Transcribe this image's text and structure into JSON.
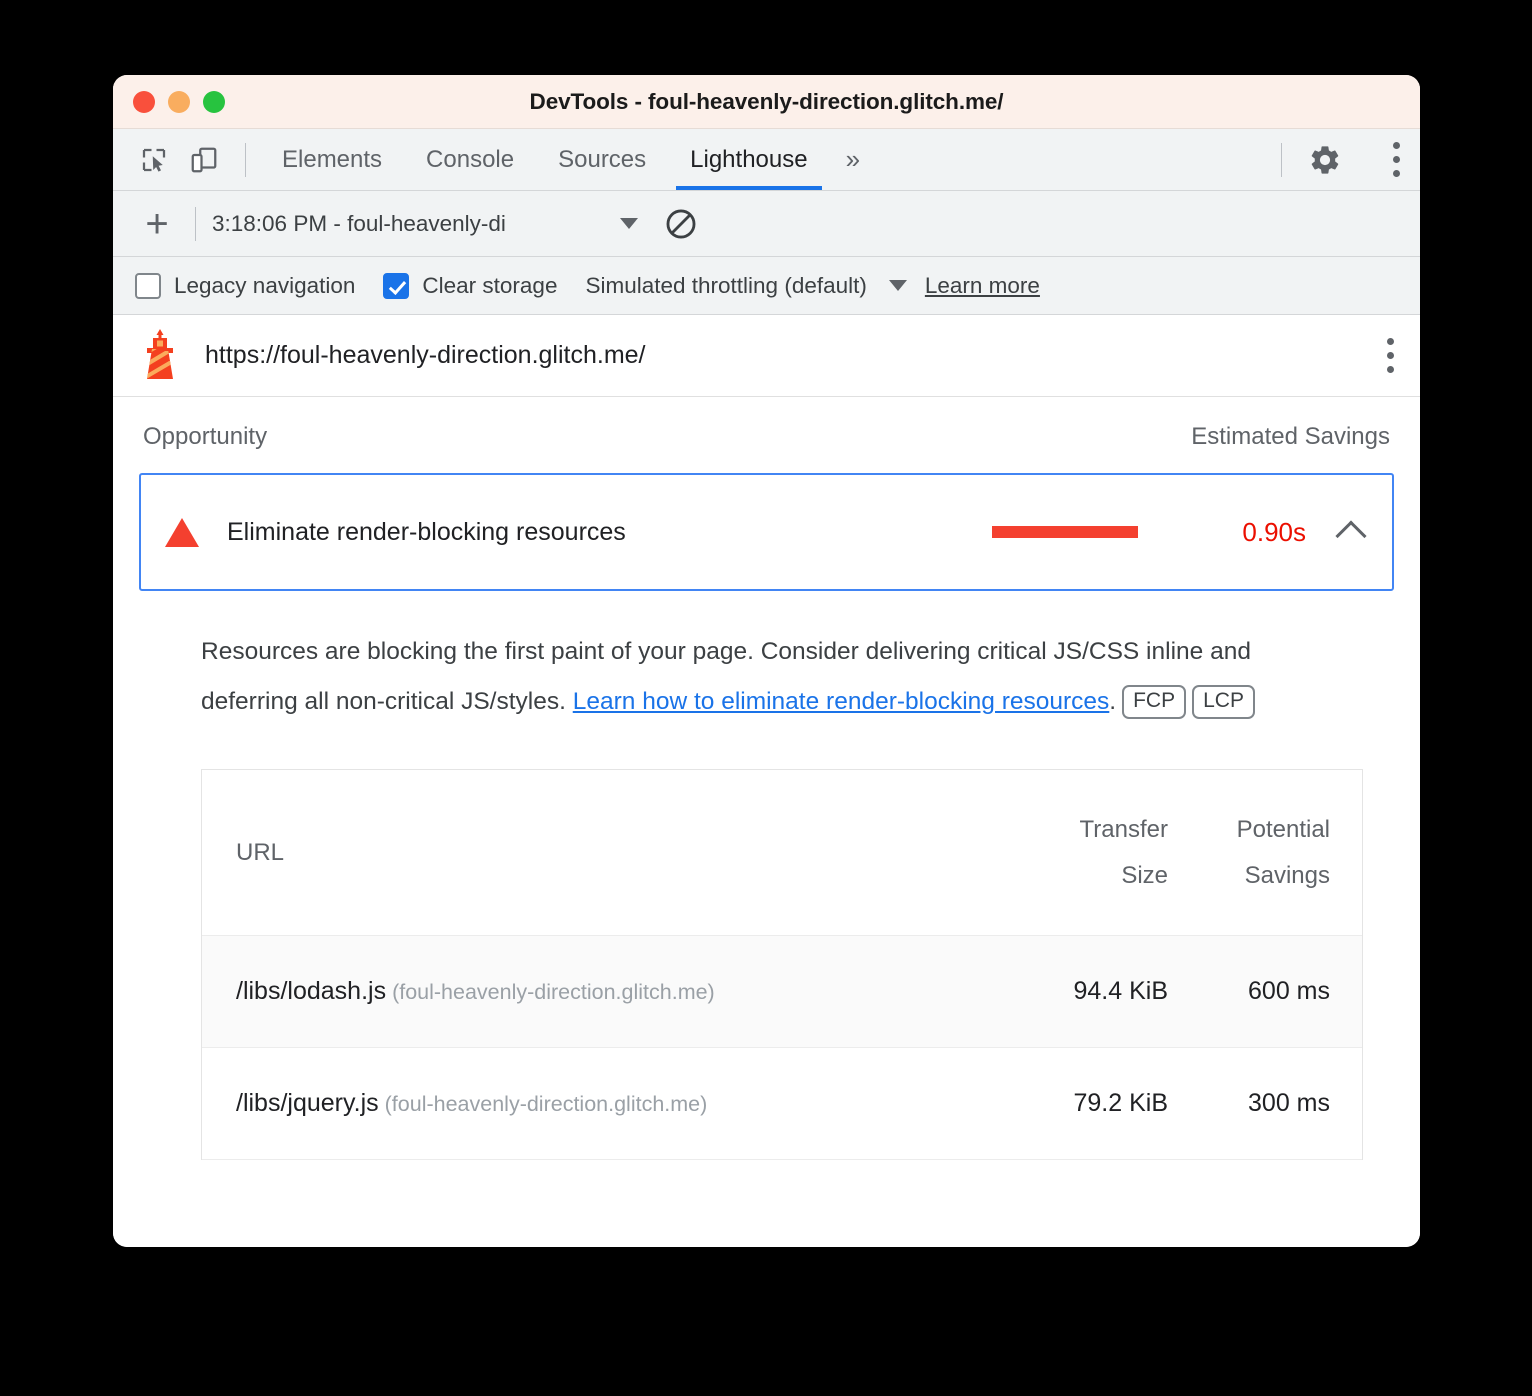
{
  "window": {
    "title": "DevTools - foul-heavenly-direction.glitch.me/",
    "traffic_lights": [
      "close-red",
      "minimize-yellow",
      "zoom-green"
    ]
  },
  "tabbar": {
    "inspect_icon": "inspect-element-icon",
    "device_icon": "device-toolbar-icon",
    "tabs": [
      {
        "label": "Elements",
        "active": false
      },
      {
        "label": "Console",
        "active": false
      },
      {
        "label": "Sources",
        "active": false
      },
      {
        "label": "Lighthouse",
        "active": true
      }
    ],
    "more_tabs": "»",
    "settings_icon": "gear-icon",
    "menu_icon": "kebab-menu-icon"
  },
  "runbar": {
    "add_label": "+",
    "report_select": "3:18:06 PM - foul-heavenly-di",
    "dropdown_icon": "chevron-down-icon",
    "clear_icon": "no-entry-icon"
  },
  "options": {
    "legacy_navigation": {
      "label": "Legacy navigation",
      "checked": false
    },
    "clear_storage": {
      "label": "Clear storage",
      "checked": true
    },
    "throttling": {
      "label": "Simulated throttling (default)",
      "dropdown_icon": "chevron-down-icon"
    },
    "learn_more": "Learn more"
  },
  "report": {
    "lighthouse_icon": "lighthouse-icon",
    "url": "https://foul-heavenly-direction.glitch.me/",
    "kebab": "kebab-menu-icon",
    "columns": {
      "opportunity": "Opportunity",
      "estimated_savings": "Estimated Savings"
    },
    "opportunity": {
      "severity_icon": "warning-triangle-icon",
      "title": "Eliminate render-blocking resources",
      "savings_value": "0.90s",
      "savings_bar_color": "#f4402f",
      "expand_icon": "chevron-up-icon",
      "description_part1": "Resources are blocking the first paint of your page. Consider delivering critical JS/CSS inline and deferring all non-critical JS/styles. ",
      "description_link": "Learn how to eliminate render-blocking resources",
      "description_part2": ".",
      "badges": [
        "FCP",
        "LCP"
      ]
    },
    "table": {
      "headers": {
        "url": "URL",
        "transfer_size_line1": "Transfer",
        "transfer_size_line2": "Size",
        "potential_savings_line1": "Potential",
        "potential_savings_line2": "Savings"
      },
      "rows": [
        {
          "path": "/libs/lodash.js",
          "host": "(foul-heavenly-direction.glitch.me)",
          "transfer_size": "94.4 KiB",
          "potential_savings": "600 ms"
        },
        {
          "path": "/libs/jquery.js",
          "host": "(foul-heavenly-direction.glitch.me)",
          "transfer_size": "79.2 KiB",
          "potential_savings": "300 ms"
        }
      ]
    }
  },
  "colors": {
    "accent_blue": "#1a73e8",
    "selection_border": "#4285f4",
    "error_red": "#f4402f",
    "savings_text_red": "#eb0f00",
    "titlebar_bg": "#fcf0ea",
    "toolbar_bg": "#f1f3f4"
  }
}
